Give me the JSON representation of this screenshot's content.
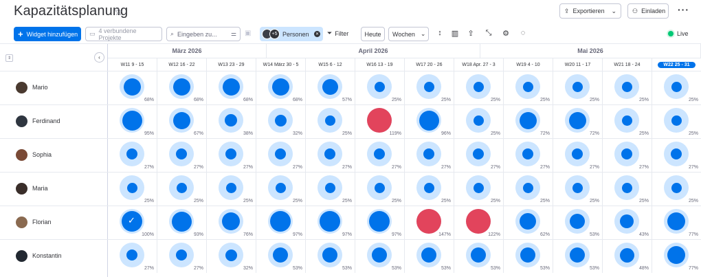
{
  "header": {
    "title": "Kapazitätsplanung",
    "star_icon": "star-icon",
    "export_label": "Exportieren",
    "invite_label": "Einladen"
  },
  "toolbar": {
    "add_widget_label": "Widget hinzufügen",
    "projects_label": "4 verbundene Projekte",
    "search_placeholder": "Eingeben zu...",
    "persons_label": "Personen",
    "persons_extra": "+5",
    "filter_label": "Filter",
    "today_label": "Heute",
    "timescale_value": "Wochen",
    "live_label": "Live"
  },
  "colors": {
    "accent": "#0073ea",
    "ring": "#cce5ff",
    "overload": "#e2445c",
    "live": "#00c875"
  },
  "months": [
    {
      "label": "März 2026"
    },
    {
      "label": "April 2026"
    },
    {
      "label": "Mai 2026"
    }
  ],
  "weeks": [
    {
      "label": "W11 9 - 15"
    },
    {
      "label": "W12 16 - 22"
    },
    {
      "label": "W13 23 - 29"
    },
    {
      "label": "W14 März 30 - 5"
    },
    {
      "label": "W15 6 - 12"
    },
    {
      "label": "W16 13 - 19"
    },
    {
      "label": "W17 20 - 26"
    },
    {
      "label": "W18 Apr. 27 - 3"
    },
    {
      "label": "W19 4 - 10"
    },
    {
      "label": "W20 11 - 17"
    },
    {
      "label": "W21 18 - 24"
    },
    {
      "label": "W22 25 - 31",
      "current": true
    }
  ],
  "people": [
    {
      "name": "Mario",
      "avatar_color": "#4a3a30",
      "loads": [
        68,
        68,
        68,
        68,
        57,
        25,
        25,
        25,
        25,
        25,
        25,
        25
      ]
    },
    {
      "name": "Ferdinand",
      "avatar_color": "#2f3640",
      "loads": [
        95,
        67,
        38,
        32,
        25,
        119,
        96,
        25,
        72,
        72,
        25,
        25
      ]
    },
    {
      "name": "Sophia",
      "avatar_color": "#7a4a36",
      "loads": [
        27,
        27,
        27,
        27,
        27,
        27,
        27,
        27,
        27,
        27,
        27,
        27
      ]
    },
    {
      "name": "Maria",
      "avatar_color": "#3a2e2a",
      "loads": [
        25,
        25,
        25,
        25,
        25,
        25,
        25,
        25,
        25,
        25,
        25,
        25
      ]
    },
    {
      "name": "Florian",
      "avatar_color": "#8a6a50",
      "loads": [
        100,
        93,
        76,
        97,
        97,
        97,
        147,
        122,
        62,
        53,
        43,
        77
      ],
      "checked_weeks": [
        0
      ]
    },
    {
      "name": "Konstantin",
      "avatar_color": "#222831",
      "loads": [
        27,
        27,
        32,
        53,
        53,
        53,
        53,
        53,
        53,
        53,
        48,
        77
      ]
    }
  ]
}
